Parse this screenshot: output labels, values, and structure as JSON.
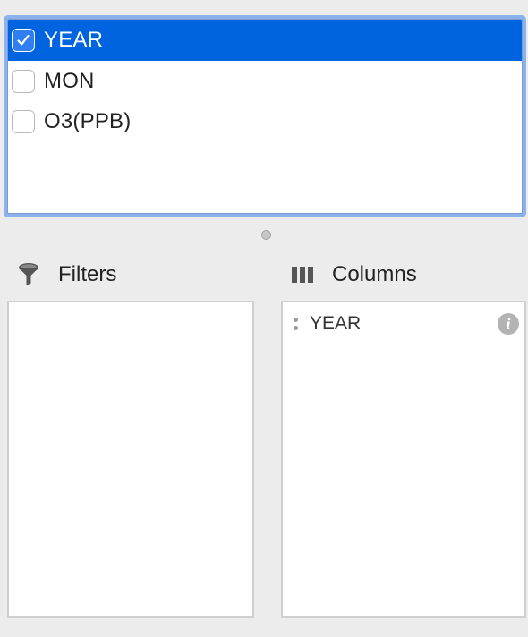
{
  "fields": [
    {
      "label": "YEAR",
      "checked": true,
      "selected": true
    },
    {
      "label": "MON",
      "checked": false,
      "selected": false
    },
    {
      "label": "O3(PPB)",
      "checked": false,
      "selected": false
    }
  ],
  "filters": {
    "title": "Filters",
    "icon": "funnel-icon",
    "items": []
  },
  "columns": {
    "title": "Columns",
    "icon": "columns-icon",
    "items": [
      {
        "label": "YEAR",
        "icon": "info-icon",
        "icon_glyph": "i"
      }
    ]
  },
  "colors": {
    "selection": "#0064e1",
    "focus_ring": "#8cb2ec",
    "background": "#ececec"
  }
}
